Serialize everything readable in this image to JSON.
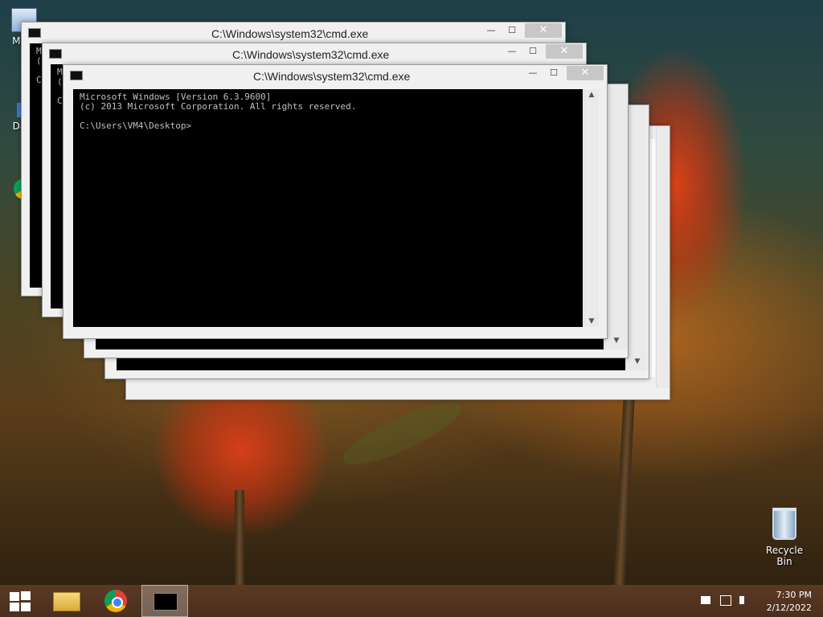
{
  "desktop": {
    "icons": [
      {
        "label": "My Computer",
        "icon": "computer-icon"
      },
      {
        "label": "Data",
        "icon": "data-icon"
      },
      {
        "label": "Google Chrome",
        "icon": "chrome-icon"
      },
      {
        "label": "Recycle Bin",
        "icon": "recycle-bin-icon"
      }
    ],
    "partial_labels": {
      "my": "My C",
      "data": "Data",
      "g": "G",
      "c": "C"
    }
  },
  "windows": [
    {
      "title": "C:\\Windows\\system32\\cmd.exe"
    },
    {
      "title": "C:\\Windows\\system32\\cmd.exe"
    },
    {
      "title": "C:\\Windows\\system32\\cmd.exe"
    },
    {
      "title": "C:\\Windows\\system32\\cmd.exe"
    },
    {
      "title": "C:\\Windows\\system32\\cmd.exe"
    },
    {
      "title": "C:\\Windows\\system32\\cmd.exe"
    }
  ],
  "window_controls": {
    "minimize": "—",
    "maximize": "☐",
    "close": "✕"
  },
  "console": {
    "line1": "Microsoft Windows [Version 6.3.9600]",
    "line2": "(c) 2013 Microsoft Corporation. All rights reserved.",
    "line3": "",
    "line4": "C:\\Users\\VM4\\Desktop>",
    "fragment_mi": "Mi",
    "fragment_c": "(c",
    "fragment_cc": "C:"
  },
  "taskbar": {
    "items": [
      "start-button",
      "file-explorer",
      "chrome",
      "command-prompt"
    ],
    "tray": {
      "time": "7:30 PM",
      "date": "2/12/2022"
    }
  }
}
